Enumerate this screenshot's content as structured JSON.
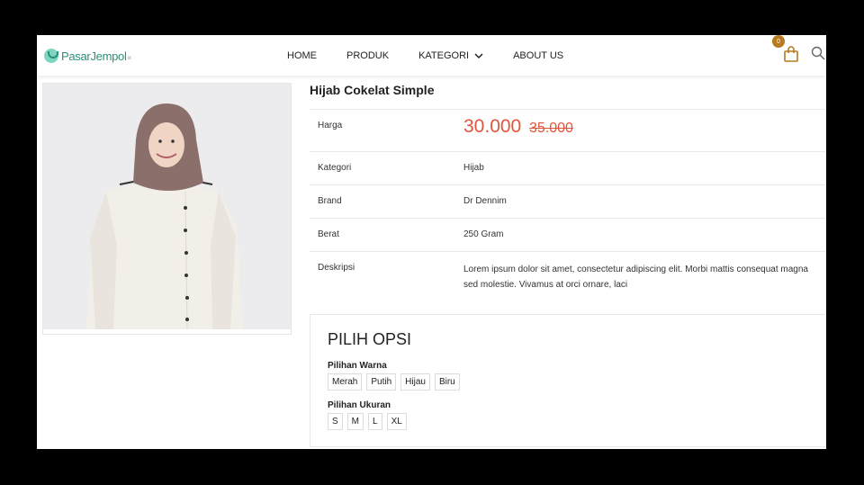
{
  "brand": {
    "name": "PasarJempol",
    "sub": "id"
  },
  "nav": {
    "items": [
      {
        "label": "HOME"
      },
      {
        "label": "PRODUK"
      },
      {
        "label": "KATEGORI"
      },
      {
        "label": "ABOUT US"
      }
    ],
    "cart_count": "0"
  },
  "product": {
    "title": "Hijab Cokelat Simple",
    "price_label": "Harga",
    "price_now": "30.000",
    "price_old": "35.000",
    "specs": [
      {
        "key": "Kategori",
        "value": "Hijab"
      },
      {
        "key": "Brand",
        "value": "Dr Dennim"
      },
      {
        "key": "Berat",
        "value": "250 Gram"
      },
      {
        "key": "Deskripsi",
        "value": "Lorem ipsum dolor sit amet, consectetur adipiscing elit. Morbi mattis consequat magna sed molestie. Vivamus at orci ornare, laci"
      }
    ]
  },
  "options": {
    "title": "PILIH OPSI",
    "color_label": "Pilihan Warna",
    "colors": [
      "Merah",
      "Putih",
      "Hijau",
      "Biru"
    ],
    "size_label": "Pilihan Ukuran",
    "sizes": [
      "S",
      "M",
      "L",
      "XL"
    ]
  },
  "colors": {
    "accent": "#e1563b",
    "brand": "#2c8f78",
    "cart": "#b77a1e"
  }
}
